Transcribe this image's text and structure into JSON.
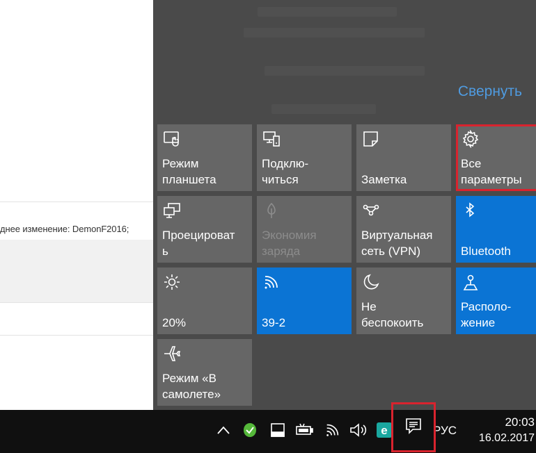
{
  "background_window": {
    "last_modified_text": "днее изменение: DemonF2016;"
  },
  "action_center": {
    "collapse_label": "Свернуть",
    "tiles": [
      {
        "id": "tablet-mode",
        "label": "Режим\nпланшета",
        "icon": "tablet-mode-icon",
        "state": "off"
      },
      {
        "id": "connect",
        "label": "Подклю-\nчиться",
        "icon": "connect-icon",
        "state": "off"
      },
      {
        "id": "note",
        "label": "Заметка",
        "icon": "note-icon",
        "state": "off"
      },
      {
        "id": "all-settings",
        "label": "Все\nпараметры",
        "icon": "gear-icon",
        "state": "off",
        "highlighted": true
      },
      {
        "id": "project",
        "label": "Проецироват\nь",
        "icon": "project-icon",
        "state": "off"
      },
      {
        "id": "battery-saver",
        "label": "Экономия\nзаряда",
        "icon": "battery-saver-icon",
        "state": "disabled"
      },
      {
        "id": "vpn",
        "label": "Виртуальная\nсеть (VPN)",
        "icon": "vpn-icon",
        "state": "off"
      },
      {
        "id": "bluetooth",
        "label": "Bluetooth",
        "icon": "bluetooth-icon",
        "state": "on"
      },
      {
        "id": "brightness",
        "label": "20%",
        "icon": "brightness-icon",
        "state": "off"
      },
      {
        "id": "wifi",
        "label": "39-2",
        "icon": "wifi-icon",
        "state": "on"
      },
      {
        "id": "quiet-hours",
        "label": "Не\nбеспокоить",
        "icon": "moon-icon",
        "state": "off"
      },
      {
        "id": "location",
        "label": "Располо-\nжение",
        "icon": "location-icon",
        "state": "on"
      },
      {
        "id": "airplane",
        "label": "Режим «В\nсамолете»",
        "icon": "airplane-icon",
        "state": "off"
      }
    ]
  },
  "taskbar": {
    "language": "РУС",
    "time": "20:03",
    "date": "16.02.2017",
    "tray_icons": [
      "chevron-up-icon",
      "security-app-icon",
      "storage-icon",
      "battery-icon",
      "wifi-icon",
      "volume-icon",
      "eset-icon",
      "notifications-icon"
    ],
    "eset_letter": "e"
  },
  "colors": {
    "panel_bg": "#4a4a4a",
    "tile_bg": "#666666",
    "tile_active": "#0b74d4",
    "accent_link": "#4f9be0",
    "highlight": "#d9232e",
    "taskbar_bg": "#101010"
  }
}
